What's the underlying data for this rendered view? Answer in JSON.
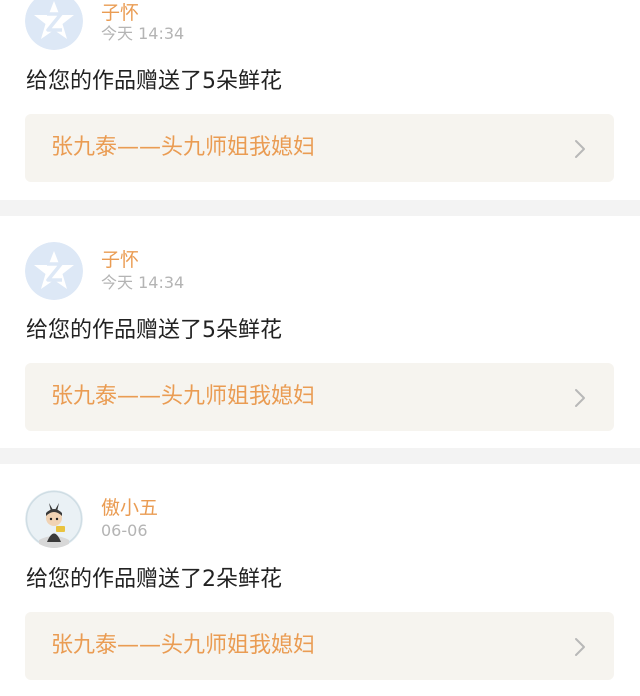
{
  "notifications": [
    {
      "username": "子怀",
      "time": "今天 14:34",
      "message": "给您的作品赠送了5朵鲜花",
      "work_title": "张九泰——头九师姐我媳妇",
      "avatar_icon": "qq-default-avatar-icon"
    },
    {
      "username": "子怀",
      "time": "今天 14:34",
      "message": "给您的作品赠送了5朵鲜花",
      "work_title": "张九泰——头九师姐我媳妇",
      "avatar_icon": "qq-default-avatar-icon"
    },
    {
      "username": "傲小五",
      "time": "06-06",
      "message": "给您的作品赠送了2朵鲜花",
      "work_title": "张九泰——头九师姐我媳妇",
      "avatar_icon": "cartoon-figure-avatar-icon"
    }
  ],
  "colors": {
    "accent": "#ea9c53",
    "link_background": "#f6f4ef",
    "separator": "#f3f3f3",
    "default_avatar": "#dde8f6"
  }
}
